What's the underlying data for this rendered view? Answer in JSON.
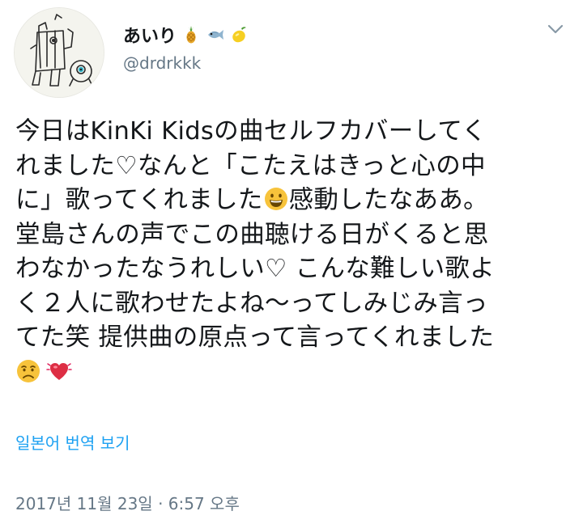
{
  "user": {
    "display_name": "あいり",
    "handle": "@drdrkkk",
    "name_emojis": [
      "pineapple-icon",
      "fish-icon",
      "lemon-icon"
    ]
  },
  "tweet": {
    "lines": [
      "今日はKinKi Kidsの曲セルフカバーしてく",
      "れました♡なんと「こたえはきっと心の中",
      [
        "に」歌ってくれました",
        "感動したなああ。"
      ],
      "堂島さんの声でこの曲聴ける日がくると思",
      "わなかったなうれしい♡ こんな難しい歌よ",
      "く２人に歌わせたよね〜ってしみじみ言っ",
      "てた笑 提供曲の原点って言ってくれました"
    ],
    "inline_emojis": [
      "grinning-face-icon",
      "disappointed-face-icon",
      "beating-heart-icon"
    ]
  },
  "translate_label": "일본어 번역 보기",
  "timestamp": "2017년 11월 23일 · 6:57 오후",
  "colors": {
    "link": "#1da1f2",
    "secondary": "#657786",
    "text": "#14171a"
  }
}
